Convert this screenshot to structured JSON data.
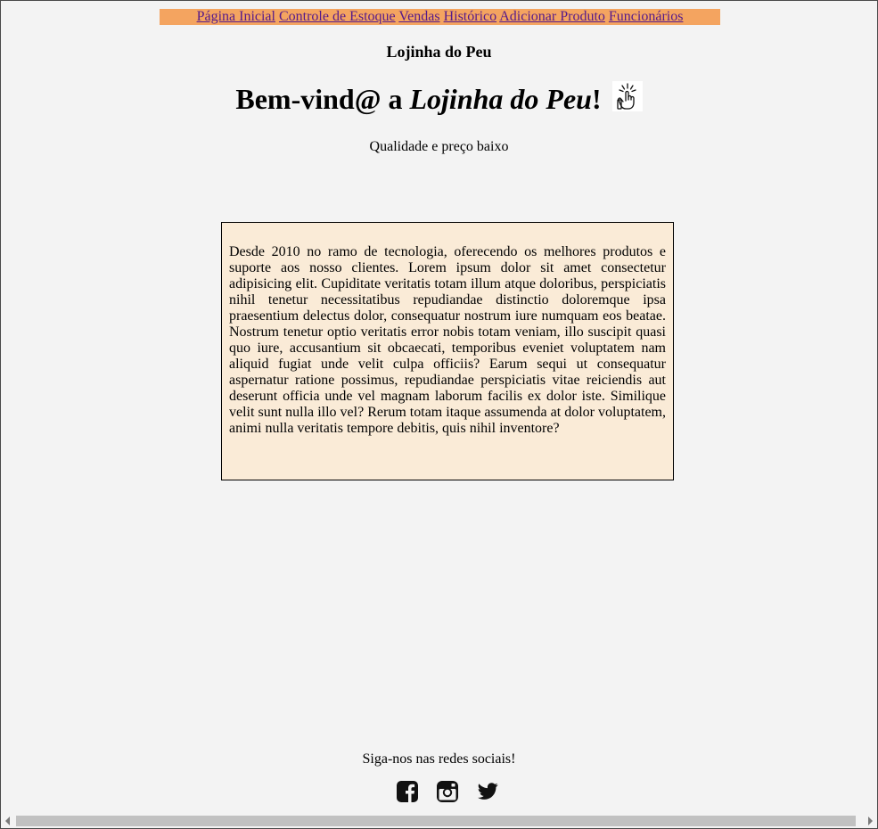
{
  "nav": {
    "items": [
      {
        "label": "Página Inicial"
      },
      {
        "label": "Controle de Estoque"
      },
      {
        "label": "Vendas"
      },
      {
        "label": "Histórico"
      },
      {
        "label": "Adicionar Produto"
      },
      {
        "label": "Funcionários"
      }
    ]
  },
  "header": {
    "site_name": "Lojinha do Peu",
    "welcome_prefix": "Bem-vind@ a ",
    "welcome_store": "Lojinha do Peu",
    "welcome_suffix": "!",
    "hand_icon": "thumbs-up-click-icon",
    "tagline": "Qualidade e preço baixo"
  },
  "about": {
    "text": "Desde 2010 no ramo de tecnologia, oferecendo os melhores produtos e suporte aos nosso clientes. Lorem ipsum dolor sit amet consectetur adipisicing elit. Cupiditate veritatis totam illum atque doloribus, perspiciatis nihil tenetur necessitatibus repudiandae distinctio doloremque ipsa praesentium delectus dolor, consequatur nostrum iure numquam eos beatae. Nostrum tenetur optio veritatis error nobis totam veniam, illo suscipit quasi quo iure, accusantium sit obcaecati, temporibus eveniet voluptatem nam aliquid fugiat unde velit culpa officiis? Earum sequi ut consequatur aspernatur ratione possimus, repudiandae perspiciatis vitae reiciendis aut deserunt officia unde vel magnam laborum facilis ex dolor iste. Similique velit sunt nulla illo vel? Rerum totam itaque assumenda at dolor voluptatem, animi nulla veritatis tempore debitis, quis nihil inventore?"
  },
  "footer": {
    "social_heading": "Siga-nos nas redes sociais!",
    "social_icons": [
      "facebook-icon",
      "instagram-icon",
      "twitter-icon"
    ]
  },
  "colors": {
    "nav_bg": "#f4a460",
    "about_bg": "#faebd7",
    "page_bg": "#f3f3f3",
    "link": "#551a8b"
  }
}
